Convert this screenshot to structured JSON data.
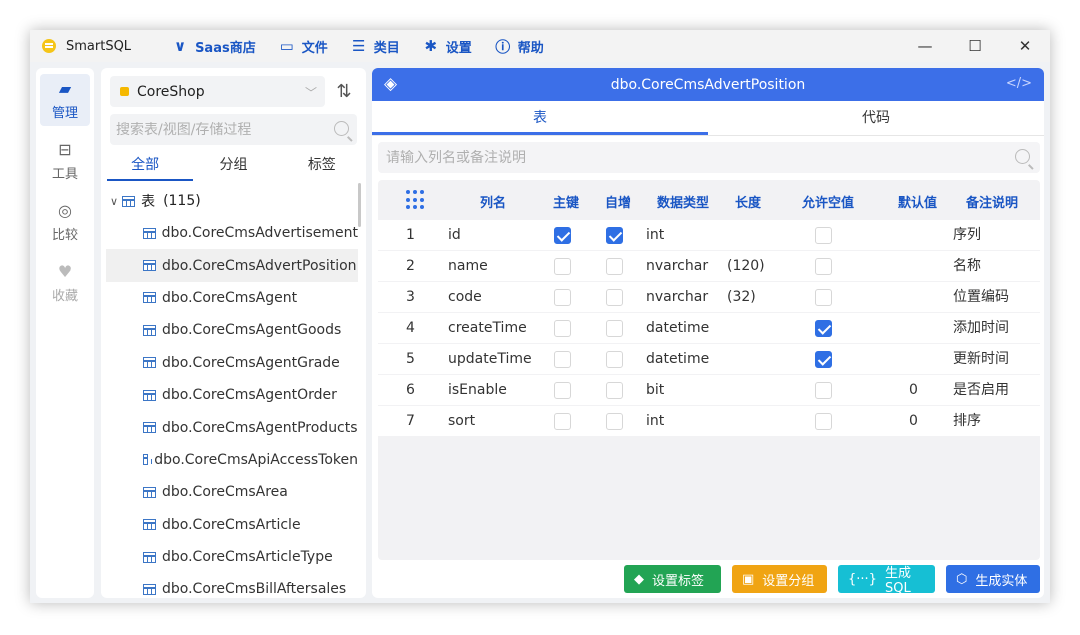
{
  "app": {
    "title": "SmartSQL"
  },
  "menu": [
    {
      "icon": "saas-chevron-icon",
      "glyph": "∨",
      "label": "Saas商店"
    },
    {
      "icon": "folder-icon",
      "glyph": "▭",
      "label": "文件"
    },
    {
      "icon": "list-icon",
      "glyph": "☰",
      "label": "类目"
    },
    {
      "icon": "gear-icon",
      "glyph": "✱",
      "label": "设置"
    },
    {
      "icon": "info-icon",
      "glyph": "ⓘ",
      "label": "帮助"
    }
  ],
  "window_controls": {
    "minimize": "—",
    "maximize": "☐",
    "close": "✕"
  },
  "rail": [
    {
      "glyph": "▰",
      "label": "管理",
      "active": true
    },
    {
      "glyph": "⊟",
      "label": "工具",
      "active": false
    },
    {
      "glyph": "◎",
      "label": "比较",
      "active": false
    },
    {
      "glyph": "♥",
      "label": "收藏",
      "active": false
    }
  ],
  "tree": {
    "database": "CoreShop",
    "search_placeholder": "搜索表/视图/存储过程",
    "tabs": [
      "全部",
      "分组",
      "标签"
    ],
    "group_label": "表",
    "group_count": "(115)",
    "items": [
      "dbo.CoreCmsAdvertisement",
      "dbo.CoreCmsAdvertPosition",
      "dbo.CoreCmsAgent",
      "dbo.CoreCmsAgentGoods",
      "dbo.CoreCmsAgentGrade",
      "dbo.CoreCmsAgentOrder",
      "dbo.CoreCmsAgentProducts",
      "dbo.CoreCmsApiAccessToken",
      "dbo.CoreCmsArea",
      "dbo.CoreCmsArticle",
      "dbo.CoreCmsArticleType",
      "dbo.CoreCmsBillAftersales"
    ],
    "selected_index": 1
  },
  "main": {
    "title": "dbo.CoreCmsAdvertPosition",
    "code_icon": "</>",
    "tabs": [
      "表",
      "代码"
    ],
    "column_search_placeholder": "请输入列名或备注说明",
    "columns": [
      "列名",
      "主键",
      "自增",
      "数据类型",
      "长度",
      "允许空值",
      "默认值",
      "备注说明"
    ],
    "rows": [
      {
        "no": "1",
        "name": "id",
        "pk": true,
        "ai": true,
        "type": "int",
        "length": "",
        "nullable": false,
        "default": "",
        "remark": "序列"
      },
      {
        "no": "2",
        "name": "name",
        "pk": false,
        "ai": false,
        "type": "nvarchar",
        "length": "(120)",
        "nullable": false,
        "default": "",
        "remark": "名称"
      },
      {
        "no": "3",
        "name": "code",
        "pk": false,
        "ai": false,
        "type": "nvarchar",
        "length": "(32)",
        "nullable": false,
        "default": "",
        "remark": "位置编码"
      },
      {
        "no": "4",
        "name": "createTime",
        "pk": false,
        "ai": false,
        "type": "datetime",
        "length": "",
        "nullable": true,
        "default": "",
        "remark": "添加时间"
      },
      {
        "no": "5",
        "name": "updateTime",
        "pk": false,
        "ai": false,
        "type": "datetime",
        "length": "",
        "nullable": true,
        "default": "",
        "remark": "更新时间"
      },
      {
        "no": "6",
        "name": "isEnable",
        "pk": false,
        "ai": false,
        "type": "bit",
        "length": "",
        "nullable": false,
        "default": "0",
        "remark": "是否启用"
      },
      {
        "no": "7",
        "name": "sort",
        "pk": false,
        "ai": false,
        "type": "int",
        "length": "",
        "nullable": false,
        "default": "0",
        "remark": "排序"
      }
    ]
  },
  "buttons": {
    "set_tag": "设置标签",
    "set_group": "设置分组",
    "gen_sql": "生成SQL",
    "gen_entity": "生成实体"
  },
  "colors": {
    "accent": "#3c6fe8",
    "tag": "#22a454",
    "group": "#f0a413",
    "sql": "#16bfd4",
    "entity": "#2f6fe4"
  }
}
